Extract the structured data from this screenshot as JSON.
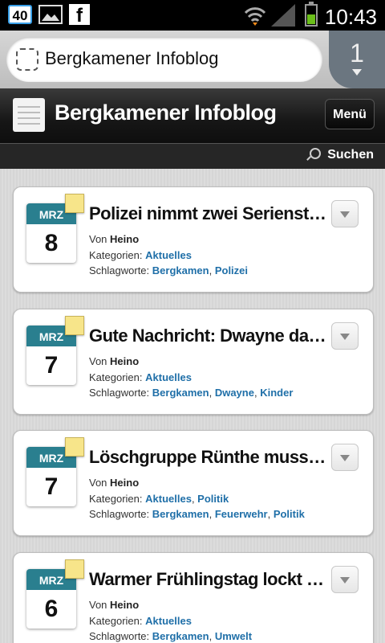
{
  "status_bar": {
    "badge": "40",
    "fb": "f",
    "time": "10:43"
  },
  "url_bar": {
    "text": "Bergkamener Infoblog",
    "tab_count": "1"
  },
  "header": {
    "title": "Bergkamener Infoblog",
    "menu_label": "Menü",
    "search_label": "Suchen"
  },
  "labels": {
    "by": "Von",
    "categories": "Kategorien:",
    "tags": "Schlagworte:"
  },
  "posts": [
    {
      "month": "MRZ",
      "day": "8",
      "title": "Polizei nimmt zwei Serienstraftä...",
      "author": "Heino",
      "categories": [
        "Aktuelles"
      ],
      "tags": [
        "Bergkamen",
        "Polizei"
      ]
    },
    {
      "month": "MRZ",
      "day": "7",
      "title": "Gute Nachricht: Dwayne darf in ...",
      "author": "Heino",
      "categories": [
        "Aktuelles"
      ],
      "tags": [
        "Bergkamen",
        "Dwayne",
        "Kinder"
      ]
    },
    {
      "month": "MRZ",
      "day": "7",
      "title": "Löschgruppe Rünthe muss für ...",
      "author": "Heino",
      "categories": [
        "Aktuelles",
        "Politik"
      ],
      "tags": [
        "Bergkamen",
        "Feuerwehr",
        "Politik"
      ]
    },
    {
      "month": "MRZ",
      "day": "6",
      "title": "Warmer Frühlingstag lockt berei...",
      "author": "Heino",
      "categories": [
        "Aktuelles"
      ],
      "tags": [
        "Bergkamen",
        "Umwelt"
      ]
    }
  ]
}
